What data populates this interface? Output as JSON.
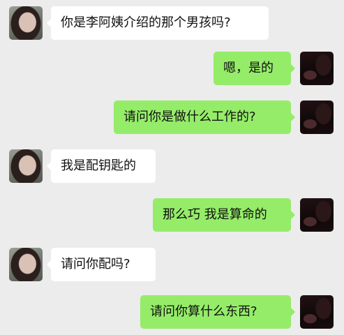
{
  "messages": [
    {
      "side": "left",
      "avatar": "girl-avatar",
      "text": "你是李阿姨介绍的那个男孩吗?"
    },
    {
      "side": "right",
      "avatar": "boy-avatar",
      "text": "嗯，是的"
    },
    {
      "side": "right",
      "avatar": "boy-avatar",
      "text": "请问你是做什么工作的?"
    },
    {
      "side": "left",
      "avatar": "girl-avatar",
      "text": "我是配钥匙的"
    },
    {
      "side": "right",
      "avatar": "boy-avatar",
      "text": "那么巧 我是算命的"
    },
    {
      "side": "left",
      "avatar": "girl-avatar",
      "text": "请问你配吗?"
    },
    {
      "side": "right",
      "avatar": "boy-avatar",
      "text": "请问你算什么东西?"
    }
  ],
  "colors": {
    "background": "#ececec",
    "incoming_bubble": "#ffffff",
    "outgoing_bubble": "#95ec69"
  }
}
